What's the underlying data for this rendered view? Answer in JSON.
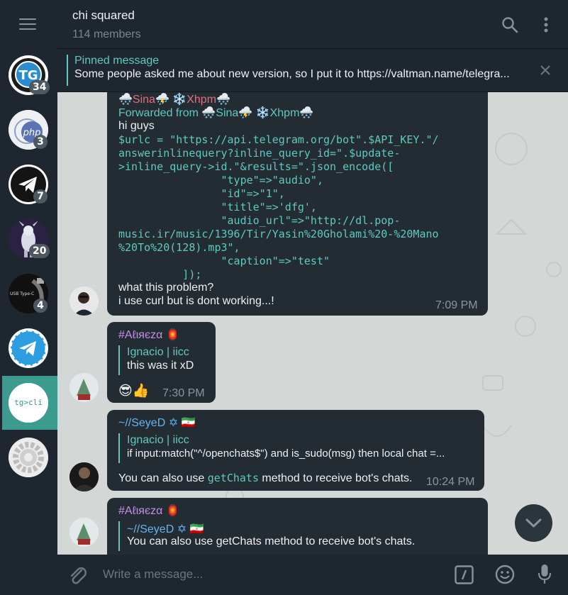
{
  "header": {
    "title": "chi squared",
    "members": "114 members"
  },
  "sidebar": {
    "chats": [
      {
        "name": "tg-group",
        "logo": "TG",
        "badge": "34"
      },
      {
        "name": "php-group",
        "logo": "php",
        "badge": "3"
      },
      {
        "name": "telegram-group",
        "badge": "7"
      },
      {
        "name": "robot-group",
        "badge": "20"
      },
      {
        "name": "usb-group",
        "logo": "USB Type-C",
        "badge": "4"
      },
      {
        "name": "telegram-blue-group"
      },
      {
        "name": "tg-cli-group",
        "logo": "tg>cli"
      },
      {
        "name": "settings-group"
      }
    ]
  },
  "pinned": {
    "label": "Pinned message",
    "text": "Some people asked me about new version, so I put it to https://valtman.name/telegra..."
  },
  "messages": {
    "m1": {
      "sender": "🌨️Sina⛈️ ❄️Xhpm🌨️",
      "forwarded_prefix": "Forwarded from",
      "forwarded_name": "🌨️Sina⛈️ ❄️Xhpm🌨️",
      "intro": "hi guys",
      "code_lines": [
        "$urlc = \"https://api.telegram.org/bot\".$API_KEY.\"/",
        "answerinlinequery?inline_query_id=\".$update-",
        ">inline_query->id.\"&results=\".json_encode([",
        "                \"type\"=>\"audio\",",
        "                \"id\"=>\"1\",",
        "                \"title\"=>'dfg',",
        "                \"audio_url\"=>\"http://dl.pop-",
        "music.ir/music/1396/Tir/Yasin%20Gholami%20-%20Mano",
        "%20To%20(128).mp3\",",
        "                \"caption\"=>\"test\"",
        "          ]);"
      ],
      "text1": "what this problem?",
      "text2": "i use curl but is dont working...!",
      "time": "7:09 PM"
    },
    "m2": {
      "sender": "#Aℓιяєzα 🏮",
      "reply_name": "Ignacio | iicc",
      "reply_text": "this was it xD",
      "text": "😎👍",
      "time": "7:30 PM"
    },
    "m3": {
      "sender": "~//SeyeD ✡ 🇮🇷",
      "reply_name": "Ignacio | iicc",
      "reply_text": "if input:match(\"^/openchats$\") and is_sudo(msg) then   local chat =...",
      "text_pre": "You can also use ",
      "text_code": "getChats",
      "text_post": " method to receive bot's chats.",
      "time": "10:24 PM"
    },
    "m4": {
      "sender": "#Aℓιяєzα 🏮",
      "reply_name": "~//SeyeD ✡ 🇮🇷",
      "reply_text": "You can also use getChats method to receive bot's chats."
    }
  },
  "composer": {
    "placeholder": "Write a message..."
  },
  "colors": {
    "accent": "#5fc9bf",
    "bubble": "#232c33",
    "panel": "#1e2730",
    "active_chat": "#3a9b8e"
  }
}
